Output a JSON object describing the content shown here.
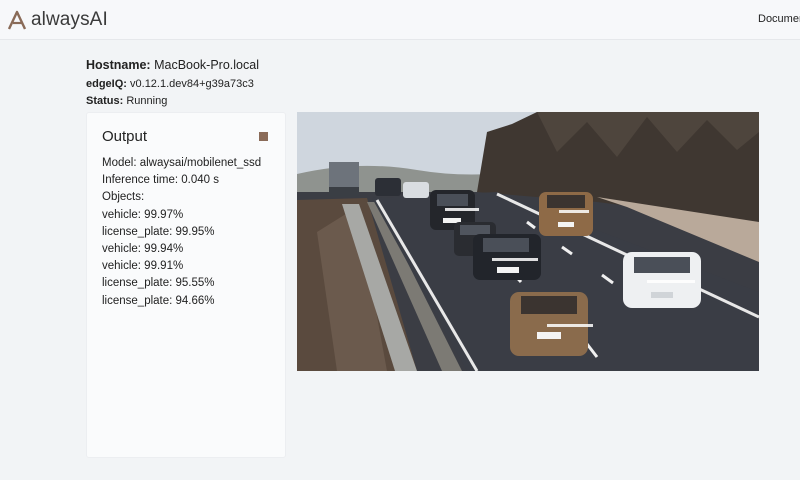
{
  "navbar": {
    "brand": "alwaysAI",
    "docs_link": "Documer"
  },
  "info": {
    "hostname_label": "Hostname:",
    "hostname_value": "MacBook-Pro.local",
    "edgeiq_label": "edgeIQ:",
    "edgeiq_value": "v0.12.1.dev84+g39a73c3",
    "status_label": "Status:",
    "status_value": "Running"
  },
  "output": {
    "title": "Output",
    "model": "Model: alwaysai/mobilenet_ssd",
    "inference_time": "Inference time: 0.040 s",
    "objects_label": "Objects:",
    "objects": [
      "vehicle: 99.97%",
      "license_plate: 99.95%",
      "vehicle: 99.94%",
      "vehicle: 99.91%",
      "license_plate: 95.55%",
      "license_plate: 94.66%"
    ]
  },
  "colors": {
    "stop_button": "#8a6b58",
    "page_background": "#f2f4f6"
  },
  "icons": {
    "brand": "alwaysai-logo-icon",
    "stop": "stop-square-icon"
  }
}
